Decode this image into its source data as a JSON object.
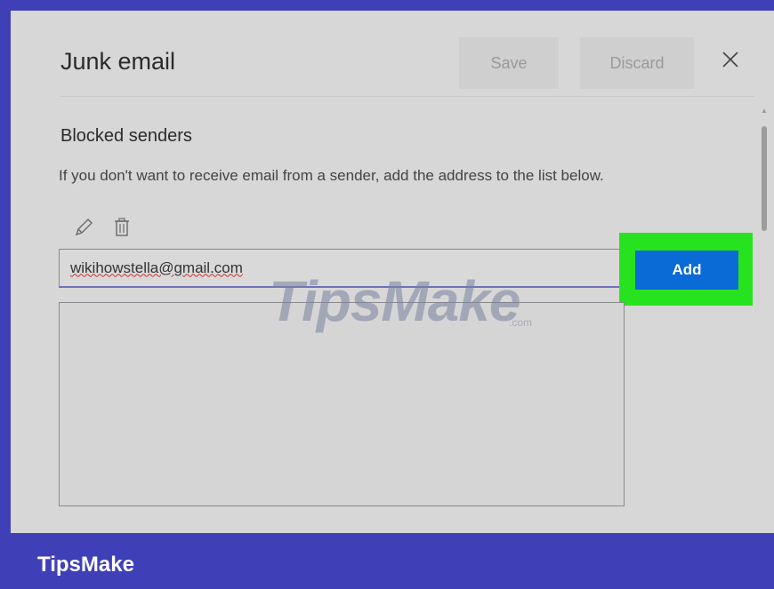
{
  "dialog": {
    "title": "Junk email",
    "save_label": "Save",
    "discard_label": "Discard",
    "close_icon": "close-icon"
  },
  "blocked_senders": {
    "heading": "Blocked senders",
    "description": "If you don't want to receive email from a sender, add the address to the list below.",
    "input_value": "wikihowstella@gmail.com",
    "add_label": "Add",
    "icons": [
      "edit-icon",
      "trash-icon"
    ]
  },
  "watermark": {
    "brand": "TipsMake",
    "suffix": ".com"
  },
  "footer": {
    "brand": "TipsMake"
  },
  "colors": {
    "frame": "#3f3fb8",
    "panel": "#d7d7d7",
    "accent": "#0a6ad6",
    "highlight": "#27e31f"
  }
}
